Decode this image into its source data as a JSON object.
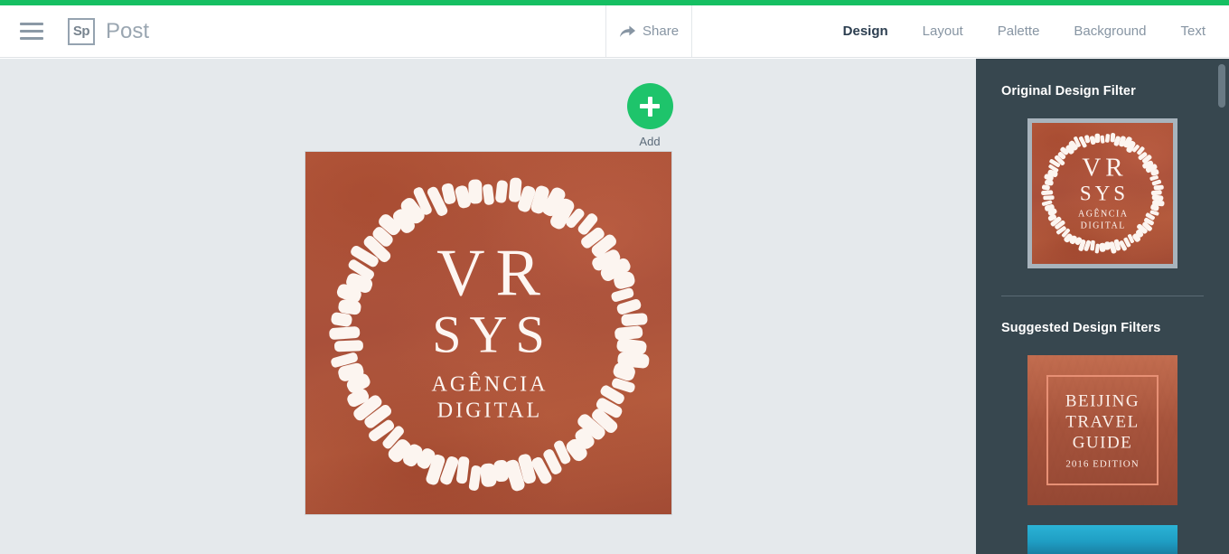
{
  "theme": {
    "accent_green": "#16bf62",
    "add_button_green": "#1ec46b",
    "sidebar_bg": "#37474f",
    "workarea_bg": "#e5e9ec",
    "artwork_base": "#b15639",
    "muted_text": "#8795a3",
    "active_tab_text": "#2c3e50"
  },
  "header": {
    "menu_icon": "hamburger-menu-icon",
    "app_mark": "Sp",
    "app_title": "Post",
    "share": {
      "icon": "share-arrow-icon",
      "label": "Share"
    },
    "tabs": [
      {
        "label": "Design",
        "active": true
      },
      {
        "label": "Layout",
        "active": false
      },
      {
        "label": "Palette",
        "active": false
      },
      {
        "label": "Background",
        "active": false
      },
      {
        "label": "Text",
        "active": false
      }
    ]
  },
  "workarea": {
    "add_button": {
      "icon": "plus-icon",
      "label": "Add"
    },
    "artwork": {
      "title_line_1": "VR",
      "title_line_2": "SYS",
      "subtitle_line_1": "AGÊNCIA",
      "subtitle_line_2": "DIGITAL",
      "decoration": "dashed-circle-wreath",
      "background_color": "#b15639"
    }
  },
  "sidebar": {
    "sections": [
      {
        "heading": "Original Design Filter",
        "items": [
          {
            "name": "vr-sys-original",
            "selected": true,
            "title_line_1": "VR",
            "title_line_2": "SYS",
            "subtitle_line_1": "AGÊNCIA",
            "subtitle_line_2": "DIGITAL"
          }
        ]
      },
      {
        "heading": "Suggested Design Filters",
        "items": [
          {
            "name": "beijing-travel-guide",
            "selected": false,
            "line_1": "BEIJING",
            "line_2": "TRAVEL",
            "line_3": "GUIDE",
            "edition": "2016 EDITION"
          },
          {
            "name": "blue-ocean-filter",
            "selected": false,
            "partially_visible": true
          }
        ]
      }
    ],
    "scrollbar": {
      "name": "sidebar-scrollbar",
      "position": "top"
    }
  }
}
